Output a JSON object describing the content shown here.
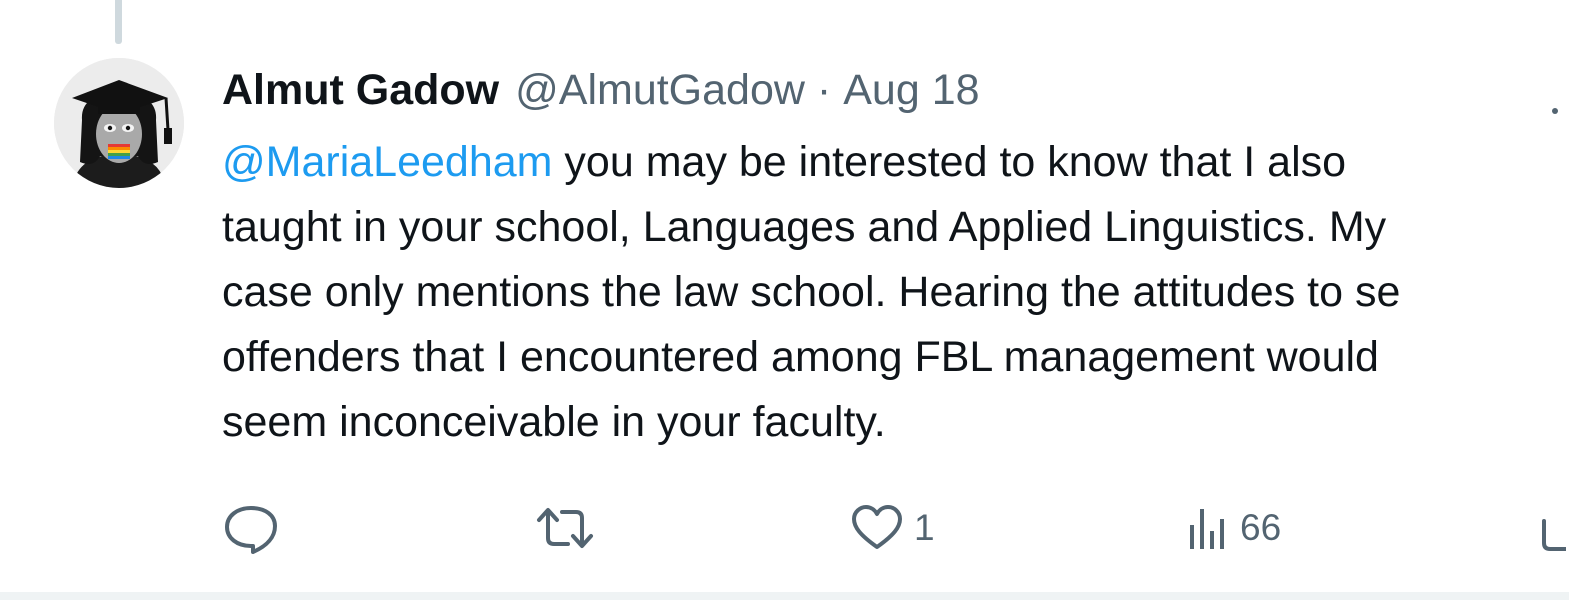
{
  "tweet": {
    "author_name": "Almut Gadow",
    "handle": "@AlmutGadow",
    "separator": "·",
    "date": "Aug 18",
    "mention": "@MariaLeedham",
    "text_line1_rest": " you may be interested to know that I also",
    "text_line2": "taught in your school, Languages and Applied Linguistics.  My",
    "text_line3": "case only mentions the law school. Hearing the attitudes to se",
    "text_line4": "offenders that I encountered among FBL management would",
    "text_line5": "seem inconceivable in your faculty."
  },
  "actions": {
    "reply_icon": "reply-icon",
    "retweet_icon": "retweet-icon",
    "like_icon": "heart-icon",
    "like_count": "1",
    "views_icon": "views-bar-icon",
    "views_count": "66",
    "share_icon": "share-icon"
  },
  "colors": {
    "text": "#0f1419",
    "secondary": "#536471",
    "accent": "#1d9bf0",
    "divider": "#eff3f4"
  }
}
